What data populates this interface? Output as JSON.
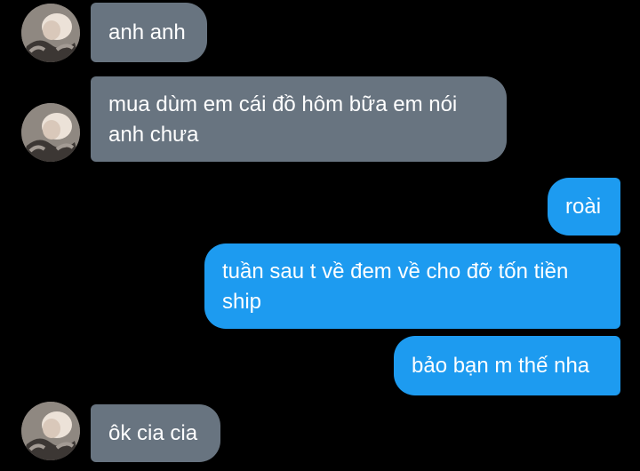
{
  "conversation": {
    "messages": [
      {
        "direction": "incoming",
        "text": "anh anh"
      },
      {
        "direction": "incoming",
        "text": "mua dùm em cái đồ hôm bữa em nói anh chưa"
      },
      {
        "direction": "outgoing",
        "text": "roài"
      },
      {
        "direction": "outgoing",
        "text": "tuần sau t về đem về cho đỡ tốn tiền ship"
      },
      {
        "direction": "outgoing",
        "text": "bảo bạn m thế nha"
      },
      {
        "direction": "incoming",
        "text": "ôk cia cia"
      }
    ],
    "avatar_icon": "contact-avatar-photo"
  },
  "colors": {
    "background": "#000000",
    "incoming_bubble": "#687480",
    "outgoing_bubble": "#1d9bf0",
    "text": "#ffffff"
  }
}
